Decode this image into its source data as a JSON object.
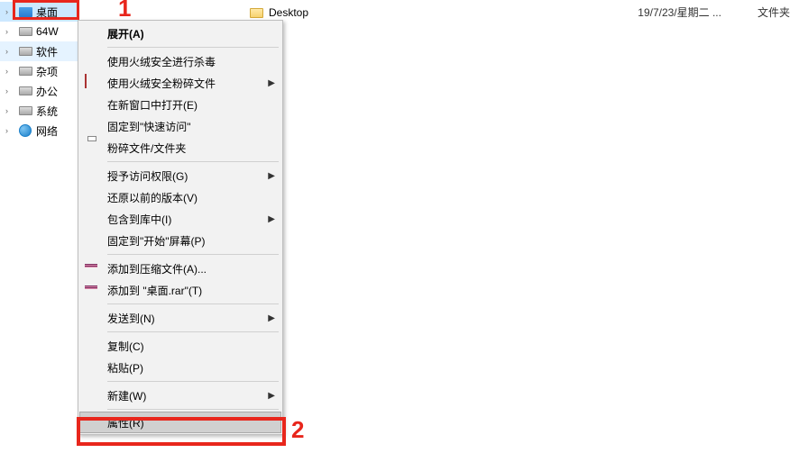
{
  "tree": {
    "items": [
      {
        "label": "桌面",
        "expandable": true,
        "selected": true,
        "icon": "monitor"
      },
      {
        "label": "64W",
        "expandable": true,
        "icon": "drive"
      },
      {
        "label": "软件",
        "expandable": true,
        "icon": "drive",
        "hover": true
      },
      {
        "label": "杂项",
        "expandable": true,
        "icon": "drive"
      },
      {
        "label": "办公",
        "expandable": true,
        "icon": "drive"
      },
      {
        "label": "系统",
        "expandable": true,
        "icon": "drive"
      },
      {
        "label": "网络",
        "expandable": true,
        "icon": "network",
        "indent": false
      }
    ]
  },
  "file": {
    "name": "Desktop",
    "date": "19/7/23/星期二 ...",
    "type": "文件夹"
  },
  "menu": [
    {
      "label": "展开(A)",
      "bold": true
    },
    {
      "sep": true
    },
    {
      "label": "使用火绒安全进行杀毒",
      "icon": "fire"
    },
    {
      "label": "使用火绒安全粉碎文件",
      "icon": "shred",
      "sub": true
    },
    {
      "label": "在新窗口中打开(E)"
    },
    {
      "label": "固定到\"快速访问\""
    },
    {
      "label": "粉碎文件/文件夹",
      "icon": "print"
    },
    {
      "sep": true
    },
    {
      "label": "授予访问权限(G)",
      "sub": true
    },
    {
      "label": "还原以前的版本(V)"
    },
    {
      "label": "包含到库中(I)",
      "sub": true
    },
    {
      "label": "固定到\"开始\"屏幕(P)"
    },
    {
      "sep": true
    },
    {
      "label": "添加到压缩文件(A)...",
      "icon": "rar"
    },
    {
      "label": "添加到 \"桌面.rar\"(T)",
      "icon": "rar"
    },
    {
      "sep": true
    },
    {
      "label": "发送到(N)",
      "sub": true
    },
    {
      "sep": true
    },
    {
      "label": "复制(C)"
    },
    {
      "label": "粘贴(P)"
    },
    {
      "sep": true
    },
    {
      "label": "新建(W)",
      "sub": true
    },
    {
      "sep": true
    },
    {
      "label": "属性(R)",
      "selected": true
    }
  ],
  "annotations": {
    "num1": "1",
    "num2": "2"
  }
}
